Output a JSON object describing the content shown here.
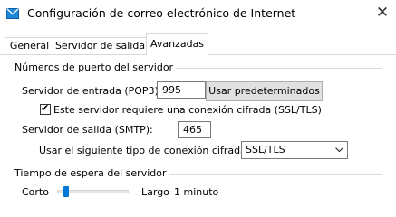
{
  "window": {
    "title": "Configuración de correo electrónico de Internet",
    "close_symbol": "✕"
  },
  "tabs": [
    {
      "label": "General",
      "active": false
    },
    {
      "label": "Servidor de salida",
      "active": false
    },
    {
      "label": "Avanzadas",
      "active": true
    }
  ],
  "ports_group": {
    "title": "Números de puerto del servidor",
    "incoming_label": "Servidor de entrada (POP3):",
    "incoming_value": "995",
    "defaults_button": "Usar predeterminados",
    "ssl_checkbox_label": "Este servidor requiere una conexión cifrada (SSL/TLS)",
    "ssl_checked": true,
    "checkmark": "✔",
    "outgoing_label": "Servidor de salida (SMTP):",
    "outgoing_value": "465",
    "encryption_label": "Usar el siguiente tipo de conexión cifrada:",
    "encryption_value": "SSL/TLS"
  },
  "timeout_group": {
    "title": "Tiempo de espera del servidor",
    "short_label": "Corto",
    "long_label": "Largo",
    "value_text": "1 minuto",
    "slider_position": 0.1
  },
  "colors": {
    "accent": "#0078d7",
    "button_bg": "#e1e1e1"
  }
}
